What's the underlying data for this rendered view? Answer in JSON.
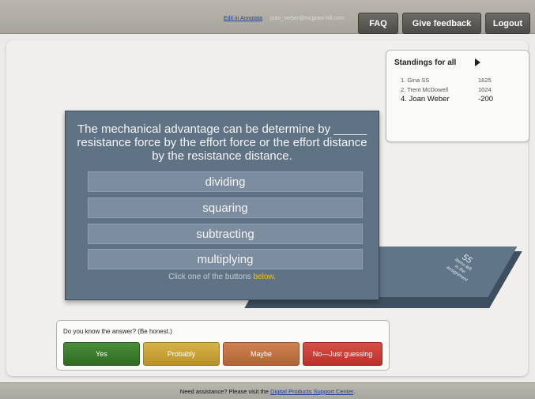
{
  "header": {
    "edit_link": "Edit in Annotata",
    "user_email": "joan_weber@mcgraw-hill.com",
    "faq": "FAQ",
    "feedback": "Give feedback",
    "logout": "Logout"
  },
  "standings": {
    "title": "Standings for all",
    "rows": [
      {
        "name": "1. Gina SS",
        "score": "1625"
      },
      {
        "name": "2. Trent McDowell",
        "score": "1024"
      },
      {
        "name": "4. Joan Weber",
        "score": "-200"
      }
    ]
  },
  "question": {
    "text": "The mechanical advantage can be determine by _____ resistance force by the effort force or the effort distance by the resistance distance.",
    "answers": [
      "dividing",
      "squaring",
      "subtracting",
      "multiplying"
    ],
    "hint_prefix": "Click one of the buttons ",
    "hint_emph": "below",
    "hint_suffix": "."
  },
  "stack": {
    "count": "55",
    "label_line1": "items left",
    "label_line2": "in the",
    "label_line3": "assignment"
  },
  "confidence": {
    "prompt": "Do you know the answer? (Be honest.)",
    "yes": "Yes",
    "probably": "Probably",
    "maybe": "Maybe",
    "no": "No—Just guessing",
    "colors": {
      "yes": "#3b7d2e",
      "probably": "#c9a535",
      "maybe": "#c1743f",
      "no": "#c83f38"
    }
  },
  "footer": {
    "text": "Need assistance? Please visit the ",
    "link": "Digital Products Support Center",
    "end": "."
  }
}
